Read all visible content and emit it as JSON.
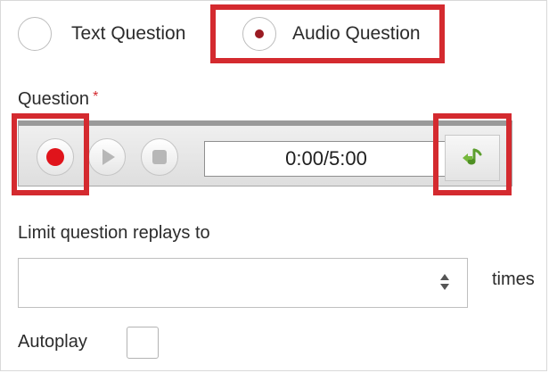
{
  "question_type": {
    "options": [
      {
        "label": "Text Question",
        "selected": false
      },
      {
        "label": "Audio Question",
        "selected": true
      }
    ]
  },
  "question": {
    "label": "Question",
    "required_marker": "*"
  },
  "recorder": {
    "time_display": "0:00/5:00",
    "buttons": [
      "record-icon",
      "play-icon",
      "stop-icon",
      "upload-audio-icon"
    ]
  },
  "replays": {
    "label": "Limit question replays to",
    "value": "",
    "placeholder": "",
    "unit": "times"
  },
  "autoplay": {
    "label": "Autoplay",
    "checked": false
  },
  "colors": {
    "highlight": "#d42a2f",
    "record": "#e0141b",
    "radio_selected": "#9a1b22",
    "upload_icon": "#5c9e2e"
  }
}
